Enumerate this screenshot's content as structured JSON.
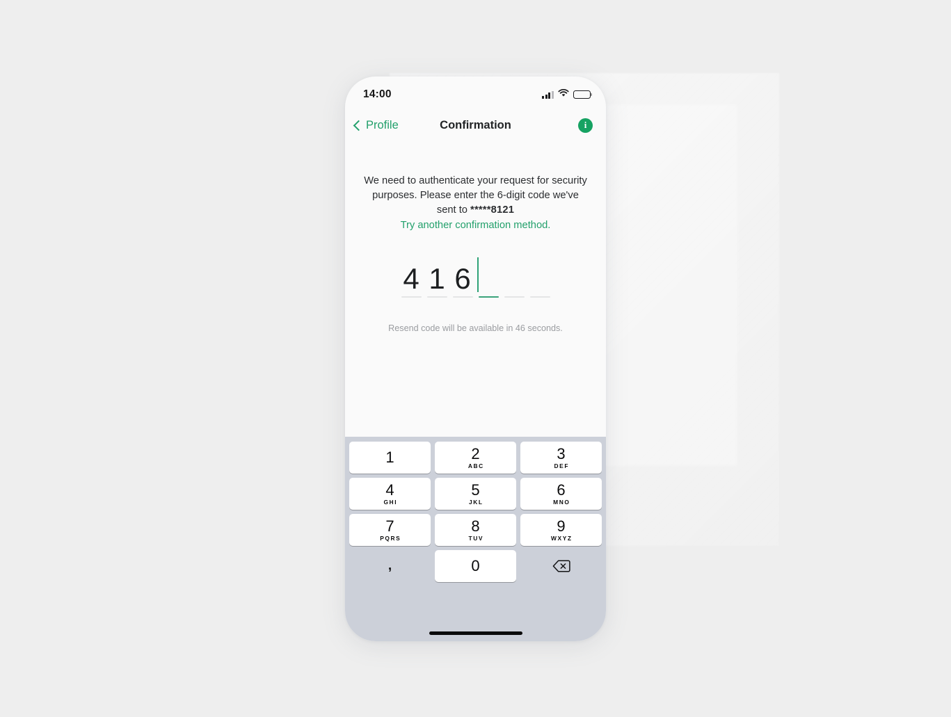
{
  "status_bar": {
    "time": "14:00",
    "cellular_icon": "signal-bars-icon",
    "wifi_icon": "wifi-icon",
    "battery_icon": "battery-icon"
  },
  "nav": {
    "back_label": "Profile",
    "back_icon": "chevron-left-icon",
    "title": "Confirmation",
    "info_label": "i",
    "info_icon": "info-icon"
  },
  "main": {
    "instruction_line1": "We need to authenticate your request for",
    "instruction_line2": "security purposes. Please enter the 6-digit",
    "instruction_line3_prefix": "code we've sent to ",
    "masked_phone": "*****8121",
    "try_another_link": "Try another confirmation method.",
    "code": {
      "length": 6,
      "entered": [
        "4",
        "1",
        "6",
        "",
        "",
        ""
      ],
      "active_index": 3
    },
    "resend_text": "Resend code will be available in 46 seconds."
  },
  "keyboard": {
    "rows": [
      [
        {
          "num": "1",
          "letters": ""
        },
        {
          "num": "2",
          "letters": "ABC"
        },
        {
          "num": "3",
          "letters": "DEF"
        }
      ],
      [
        {
          "num": "4",
          "letters": "GHI"
        },
        {
          "num": "5",
          "letters": "JKL"
        },
        {
          "num": "6",
          "letters": "MNO"
        }
      ],
      [
        {
          "num": "7",
          "letters": "PQRS"
        },
        {
          "num": "8",
          "letters": "TUV"
        },
        {
          "num": "9",
          "letters": "WXYZ"
        }
      ]
    ],
    "comma_key": ",",
    "zero_key": "0",
    "backspace_icon": "backspace-icon"
  },
  "colors": {
    "accent_green": "#22a06b",
    "info_green": "#16a262",
    "keyboard_bg": "#ccd0d9",
    "page_bg": "#eeeeee",
    "screen_bg": "#fafafa",
    "muted_text": "#9a9ca0"
  }
}
